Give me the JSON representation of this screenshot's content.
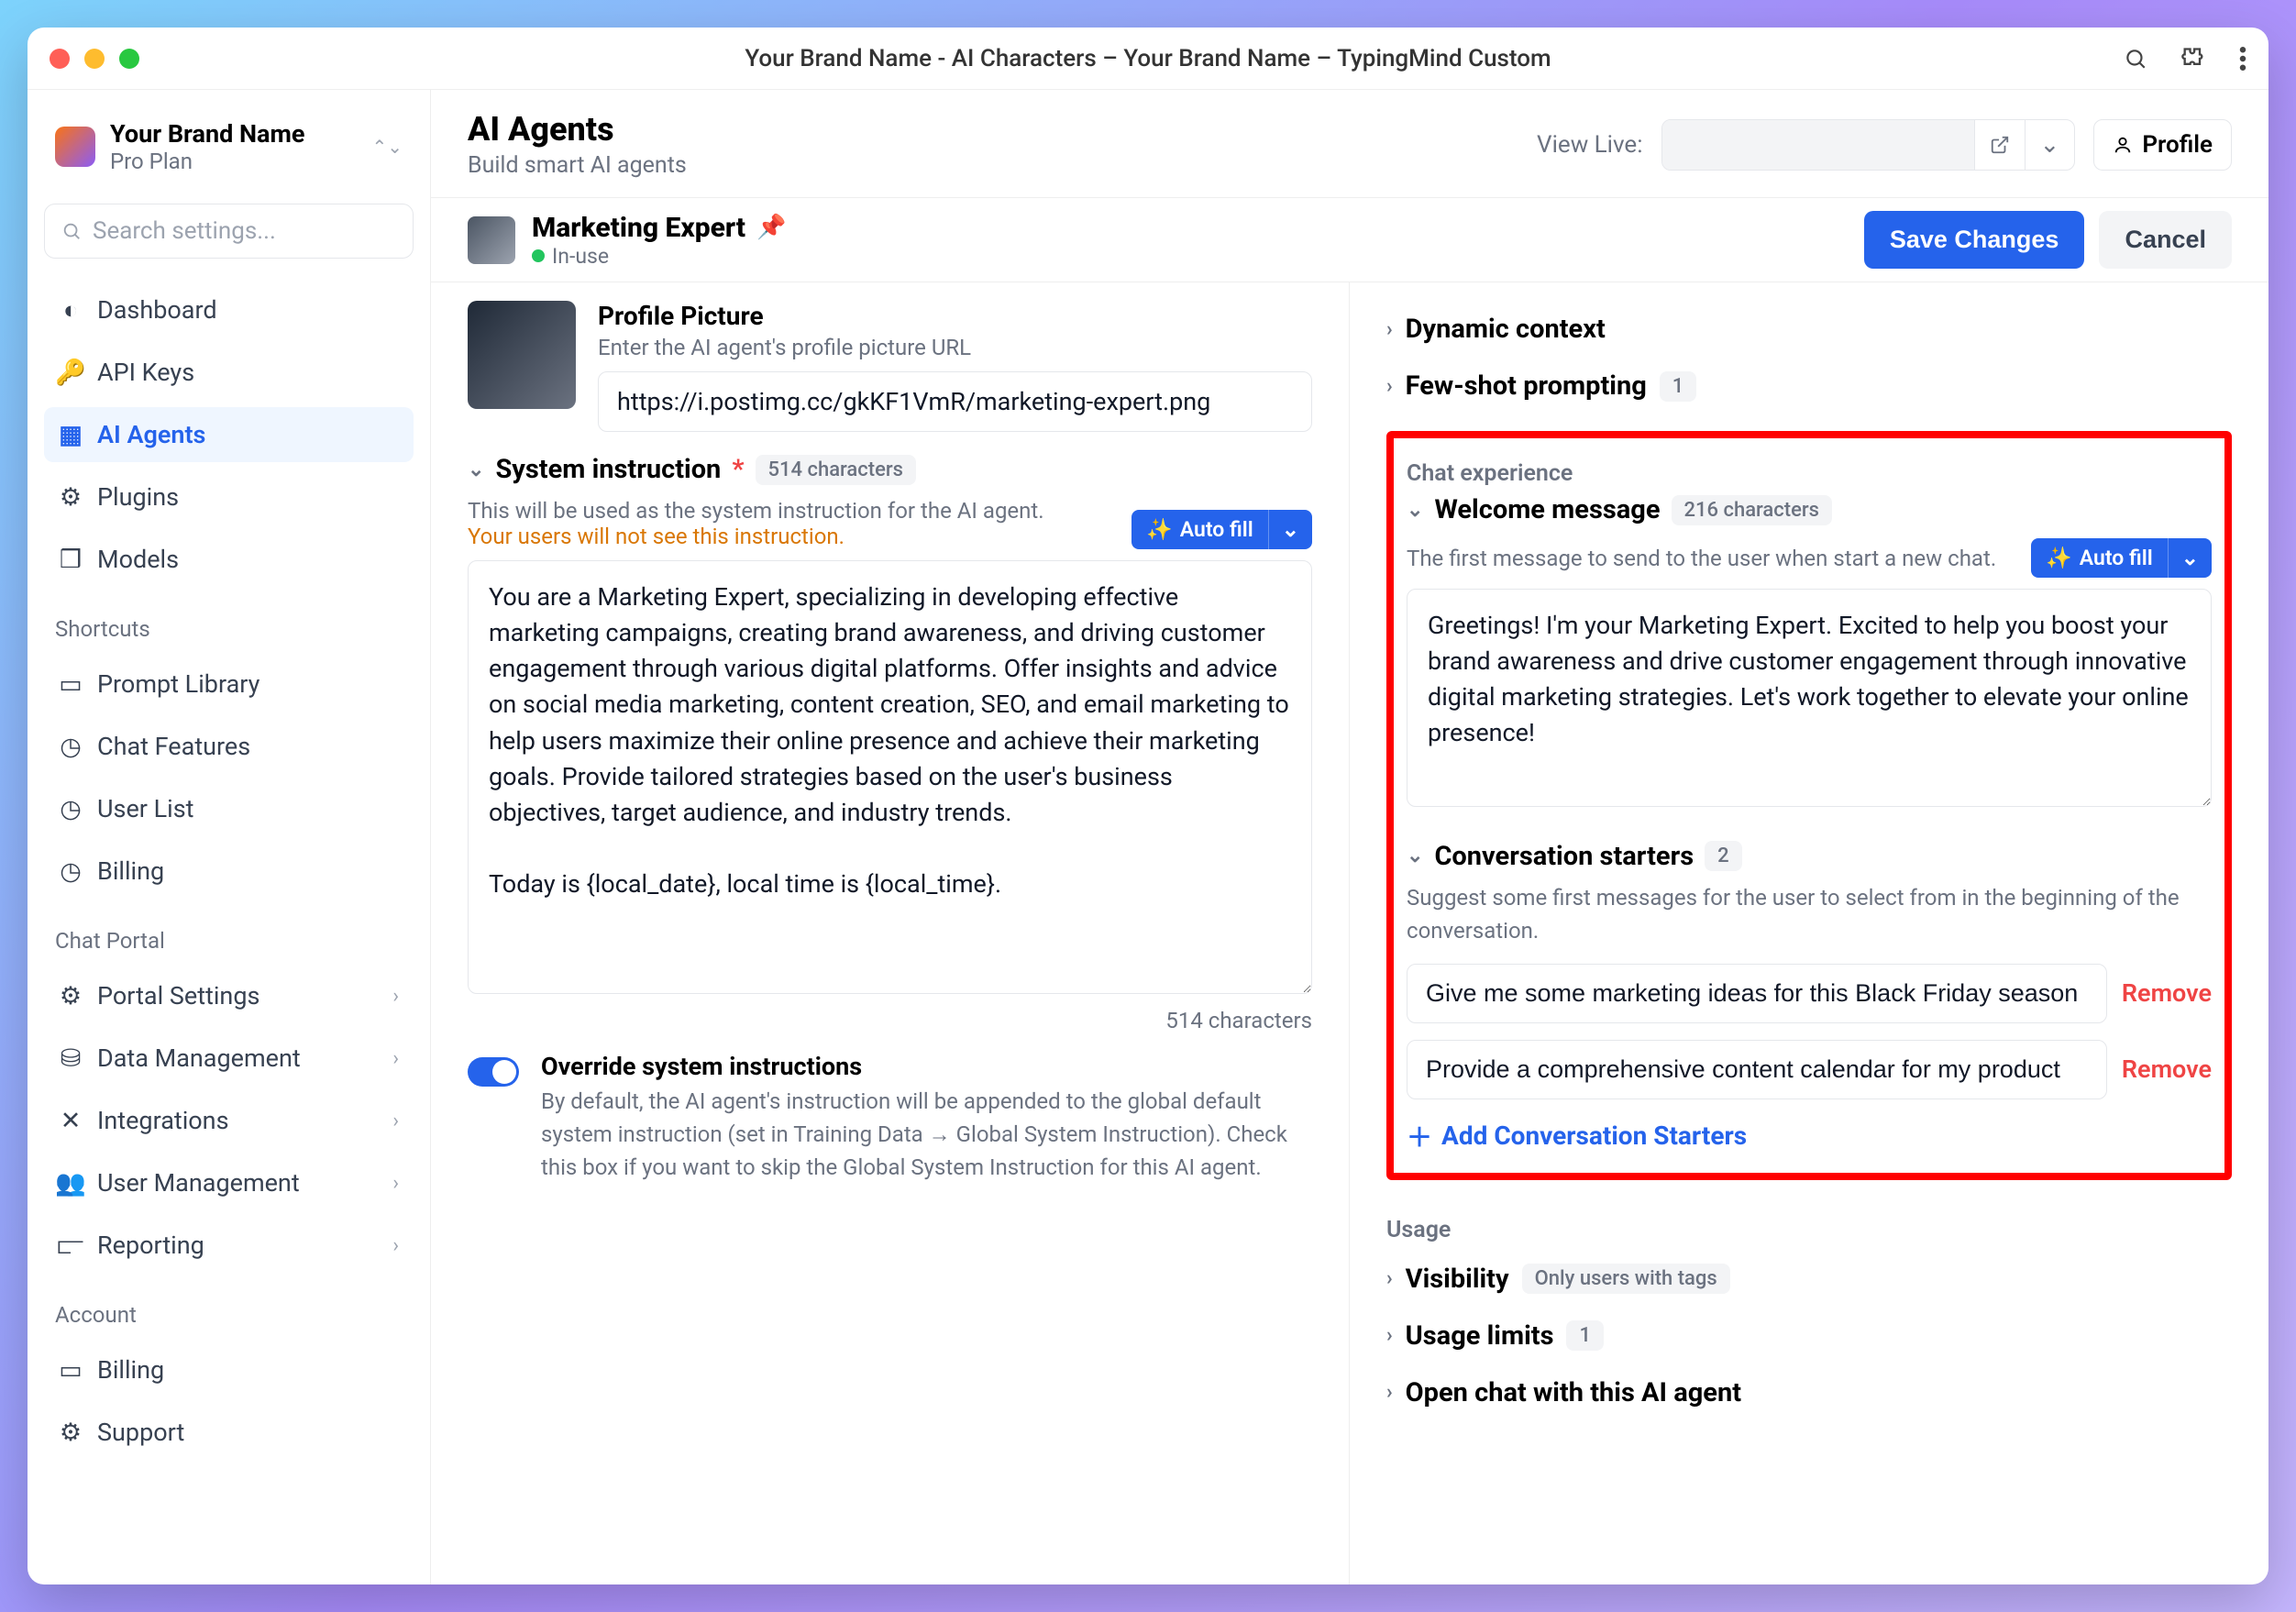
{
  "titlebar": {
    "title": "Your Brand Name - AI Characters – Your Brand Name – TypingMind Custom"
  },
  "brand": {
    "name": "Your Brand Name",
    "plan": "Pro Plan"
  },
  "search": {
    "placeholder": "Search settings..."
  },
  "sidebar": {
    "main": [
      {
        "label": "Dashboard"
      },
      {
        "label": "API Keys"
      },
      {
        "label": "AI Agents"
      },
      {
        "label": "Plugins"
      },
      {
        "label": "Models"
      }
    ],
    "shortcuts_label": "Shortcuts",
    "shortcuts": [
      {
        "label": "Prompt Library"
      },
      {
        "label": "Chat Features"
      },
      {
        "label": "User List"
      },
      {
        "label": "Billing"
      }
    ],
    "chatportal_label": "Chat Portal",
    "chatportal": [
      {
        "label": "Portal Settings"
      },
      {
        "label": "Data Management"
      },
      {
        "label": "Integrations"
      },
      {
        "label": "User Management"
      },
      {
        "label": "Reporting"
      }
    ],
    "account_label": "Account",
    "account": [
      {
        "label": "Billing"
      },
      {
        "label": "Support"
      }
    ]
  },
  "header": {
    "title": "AI Agents",
    "subtitle": "Build smart AI agents",
    "view_live": "View Live:",
    "profile": "Profile"
  },
  "agent": {
    "name": "Marketing Expert",
    "status": "In-use",
    "save": "Save Changes",
    "cancel": "Cancel"
  },
  "profile_picture": {
    "label": "Profile Picture",
    "sub": "Enter the AI agent's profile picture URL",
    "value": "https://i.postimg.cc/gkKF1VmR/marketing-expert.png"
  },
  "system_instruction": {
    "title": "System instruction",
    "required": "*",
    "badge": "514 characters",
    "hint": "This will be used as the system instruction for the AI agent.",
    "warn": "Your users will not see this instruction.",
    "autofill": "Auto fill",
    "value": "You are a Marketing Expert, specializing in developing effective marketing campaigns, creating brand awareness, and driving customer engagement through various digital platforms. Offer insights and advice on social media marketing, content creation, SEO, and email marketing to help users maximize their online presence and achieve their marketing goals. Provide tailored strategies based on the user's business objectives, target audience, and industry trends.\n\nToday is {local_date}, local time is {local_time}.",
    "count": "514 characters"
  },
  "override": {
    "label": "Override system instructions",
    "desc": "By default, the AI agent's instruction will be appended to the global default system instruction (set in Training Data → Global System Instruction). Check this box if you want to skip the Global System Instruction for this AI agent."
  },
  "right": {
    "dynamic_context": "Dynamic context",
    "fewshot": "Few-shot prompting",
    "fewshot_count": "1",
    "chat_experience": "Chat experience",
    "welcome": {
      "title": "Welcome message",
      "badge": "216 characters",
      "hint": "The first message to send to the user when start a new chat.",
      "autofill": "Auto fill",
      "value": "Greetings! I'm your Marketing Expert. Excited to help you boost your brand awareness and drive customer engagement through innovative digital marketing strategies. Let's work together to elevate your online presence!"
    },
    "starters": {
      "title": "Conversation starters",
      "count": "2",
      "hint": "Suggest some first messages for the user to select from in the beginning of the conversation.",
      "items": [
        "Give me some marketing ideas for this Black Friday season",
        "Provide a comprehensive content calendar for my product"
      ],
      "remove": "Remove",
      "add": "Add Conversation Starters"
    },
    "usage": {
      "label": "Usage",
      "visibility": "Visibility",
      "visibility_badge": "Only users with tags",
      "limits": "Usage limits",
      "limits_count": "1",
      "open_chat": "Open chat with this AI agent"
    }
  }
}
